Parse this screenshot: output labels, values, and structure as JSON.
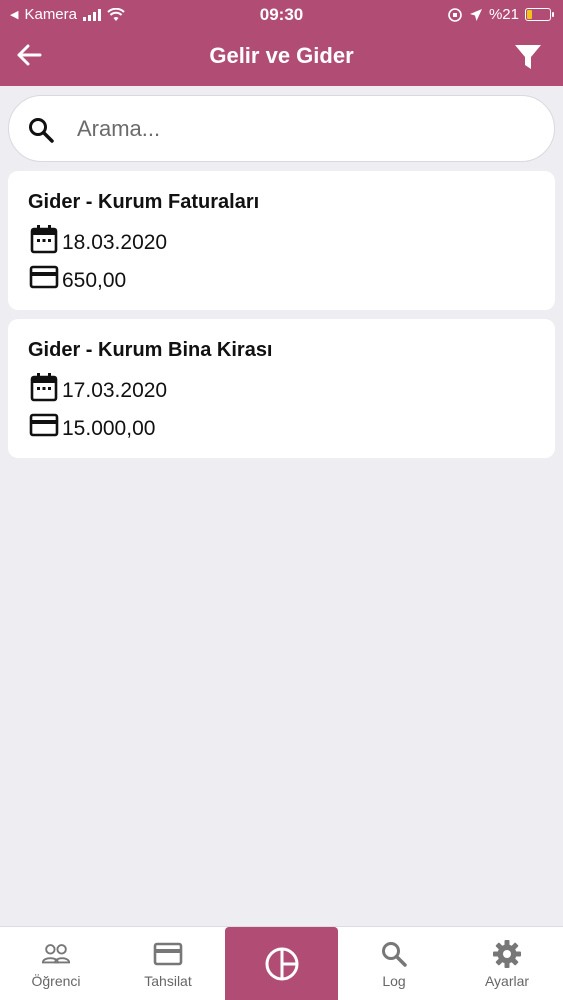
{
  "status_bar": {
    "carrier": "Kamera",
    "time": "09:30",
    "battery": "%21",
    "battery_level": 0.21
  },
  "header": {
    "title": "Gelir ve Gider",
    "back_icon": "arrow-left-icon",
    "filter_icon": "filter-icon"
  },
  "search": {
    "placeholder": "Arama...",
    "value": ""
  },
  "entries": [
    {
      "title": "Gider - Kurum Faturaları",
      "date": "18.03.2020",
      "amount": "650,00"
    },
    {
      "title": "Gider - Kurum Bina Kirası",
      "date": "17.03.2020",
      "amount": "15.000,00"
    }
  ],
  "bottom_nav": {
    "items": [
      {
        "label": "Öğrenci",
        "icon": "people-icon"
      },
      {
        "label": "Tahsilat",
        "icon": "credit-card-icon"
      },
      {
        "label": "",
        "icon": "pie-chart-icon"
      },
      {
        "label": "Log",
        "icon": "search-icon"
      },
      {
        "label": "Ayarlar",
        "icon": "gear-icon"
      }
    ]
  },
  "colors": {
    "brand": "#b14c74",
    "background": "#ededf2"
  }
}
